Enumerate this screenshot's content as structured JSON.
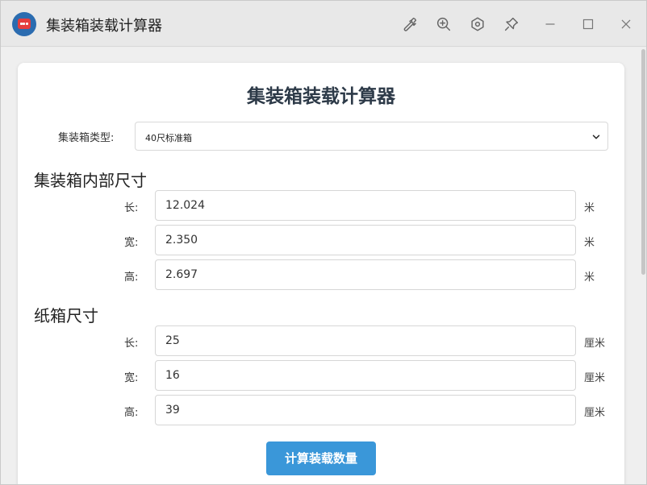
{
  "window": {
    "title": "集装箱装载计算器"
  },
  "toolbar": {
    "icons": [
      "wrench-icon",
      "zoom-in-icon",
      "hexagon-settings-icon",
      "pin-icon",
      "minimize-icon",
      "maximize-icon",
      "close-icon"
    ]
  },
  "main": {
    "heading": "集装箱装载计算器",
    "container_type": {
      "label": "集装箱类型:",
      "selected": "40尺标准箱"
    },
    "inner_size": {
      "title": "集装箱内部尺寸",
      "fields": [
        {
          "label": "长:",
          "value": "12.024",
          "unit": "米"
        },
        {
          "label": "宽:",
          "value": "2.350",
          "unit": "米"
        },
        {
          "label": "高:",
          "value": "2.697",
          "unit": "米"
        }
      ]
    },
    "box_size": {
      "title": "纸箱尺寸",
      "fields": [
        {
          "label": "长:",
          "value": "25",
          "unit": "厘米"
        },
        {
          "label": "宽:",
          "value": "16",
          "unit": "厘米"
        },
        {
          "label": "高:",
          "value": "39",
          "unit": "厘米"
        }
      ]
    },
    "calculate_button": "计算装载数量"
  },
  "colors": {
    "accent": "#3a97d9",
    "heading": "#2d3a48"
  }
}
